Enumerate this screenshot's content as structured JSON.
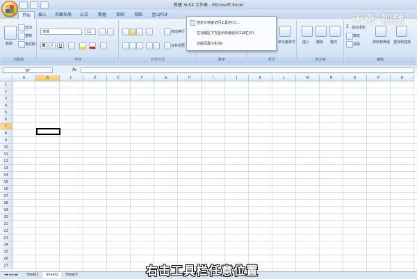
{
  "window": {
    "title": "新建 XLSX 工作表 - Microsoft Excel"
  },
  "tabs": [
    {
      "label": "开始",
      "active": true
    },
    {
      "label": "插入"
    },
    {
      "label": "页面布局"
    },
    {
      "label": "公式"
    },
    {
      "label": "数据"
    },
    {
      "label": "审阅"
    },
    {
      "label": "视图"
    },
    {
      "label": "金山PDF"
    }
  ],
  "ribbon": {
    "clipboard": {
      "paste": "粘贴",
      "cut": "剪切",
      "copy": "复制",
      "format_painter": "格式刷",
      "label": "剪贴板"
    },
    "font": {
      "name": "宋体",
      "size": "11",
      "label": "字体"
    },
    "alignment": {
      "wrap_text": "自动换行",
      "merge_center": "合并后居",
      "label": "对齐方式"
    },
    "number": {
      "label": "数字"
    },
    "styles": {
      "label": "样式",
      "cell_styles": "单元格样式"
    },
    "cells": {
      "insert": "插入",
      "delete": "删除",
      "format": "格式",
      "label": "单元格"
    },
    "editing": {
      "autosum": "自动求和",
      "fill": "填充",
      "clear": "清除",
      "sort_filter": "排序和筛选",
      "find_select": "查找和选择",
      "label": "编辑"
    }
  },
  "qat_menu": {
    "items": [
      "自定义快速访问工具栏(C)...",
      "在功能区下方显示快速访问工具栏(S)",
      "功能区最小化(N)"
    ]
  },
  "formula_bar": {
    "name_box": "B7",
    "fx": "fx",
    "value": ""
  },
  "grid": {
    "columns": [
      "A",
      "B",
      "C",
      "D",
      "E",
      "F",
      "G",
      "H",
      "I",
      "J",
      "K",
      "L",
      "M",
      "N",
      "O",
      "P",
      "Q"
    ],
    "rows": [
      "1",
      "2",
      "3",
      "4",
      "5",
      "6",
      "7",
      "8",
      "9",
      "10",
      "11",
      "12",
      "13",
      "14",
      "15",
      "16",
      "17",
      "18",
      "19",
      "20",
      "21",
      "22",
      "23",
      "24",
      "25",
      "26",
      "27"
    ],
    "selected": "B7"
  },
  "sheets": [
    {
      "label": "Sheet1"
    },
    {
      "label": "Sheet2",
      "active": true
    },
    {
      "label": "Sheet3"
    }
  ],
  "watermark": "天奇·视频",
  "subtitle": "右击工具栏任意位置"
}
